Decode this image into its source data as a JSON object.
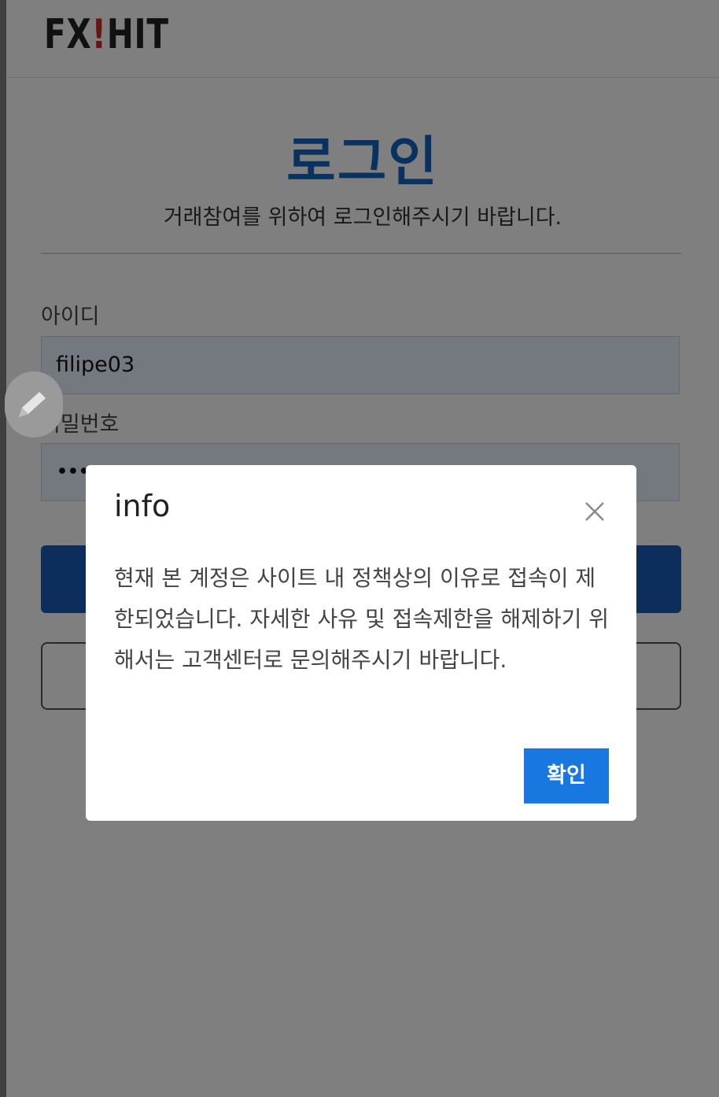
{
  "header": {
    "logo_prefix": "FX",
    "logo_bang": "!",
    "logo_suffix": "HIT"
  },
  "login": {
    "title": "로그인",
    "subtitle": "거래참여를 위하여 로그인해주시기 바랍니다.",
    "id_label": "아이디",
    "id_value": "filipe03",
    "password_label": "비밀번호",
    "password_value": "••••",
    "primary_button_label": "",
    "secondary_button_label": ""
  },
  "modal": {
    "title": "info",
    "message": "현재 본 계정은 사이트 내 정책상의 이유로 접속이 제한되었습니다. 자세한 사유 및 접속제한을 해제하기 위해서는 고객센터로 문의해주시기 바랍니다.",
    "ok_label": "확인",
    "close_icon": "close-icon"
  },
  "colors": {
    "brand_blue": "#1565c0",
    "primary_button": "#1a5bb8",
    "ok_button": "#1878e0",
    "logo_accent": "#d0281f"
  },
  "floating": {
    "icon": "pencil-icon"
  }
}
